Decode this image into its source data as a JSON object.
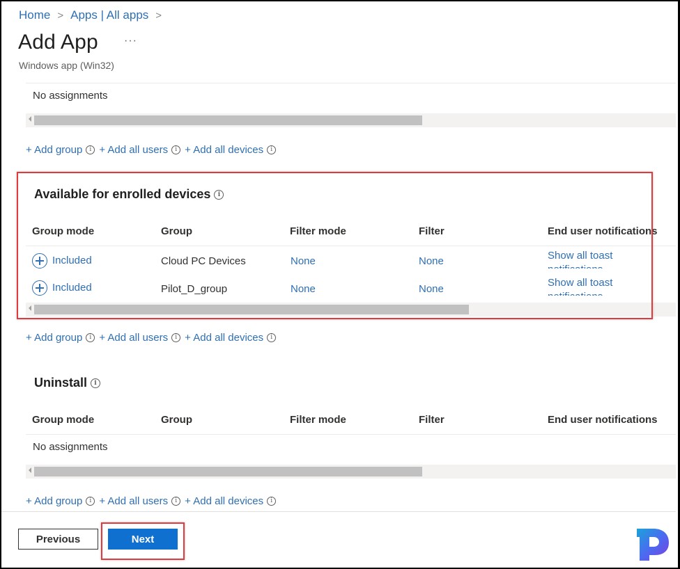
{
  "breadcrumb": {
    "items": [
      "Home",
      "Apps | All apps"
    ],
    "separator": ">"
  },
  "header": {
    "title": "Add App",
    "more_label": "···",
    "subtitle": "Windows app (Win32)"
  },
  "required_section": {
    "empty_text": "No assignments"
  },
  "add_links": {
    "add_group": "+ Add group",
    "add_all_users": "+ Add all users",
    "add_all_devices": "+ Add all devices",
    "info_glyph": "i"
  },
  "available_section": {
    "title": "Available for enrolled devices",
    "columns": [
      "Group mode",
      "Group",
      "Filter mode",
      "Filter",
      "End user notifications"
    ],
    "rows": [
      {
        "group_mode": "Included",
        "group": "Cloud PC Devices",
        "filter_mode": "None",
        "filter": "None",
        "notifications": "Show all toast notifications"
      },
      {
        "group_mode": "Included",
        "group": "Pilot_D_group",
        "filter_mode": "None",
        "filter": "None",
        "notifications": "Show all toast notifications"
      }
    ]
  },
  "uninstall_section": {
    "title": "Uninstall",
    "columns": [
      "Group mode",
      "Group",
      "Filter mode",
      "Filter",
      "End user notifications"
    ],
    "empty_text": "No assignments"
  },
  "footer": {
    "previous_label": "Previous",
    "next_label": "Next"
  },
  "colors": {
    "link": "#2f6fb3",
    "primary_button": "#1070d0",
    "highlight": "#e0393e"
  }
}
